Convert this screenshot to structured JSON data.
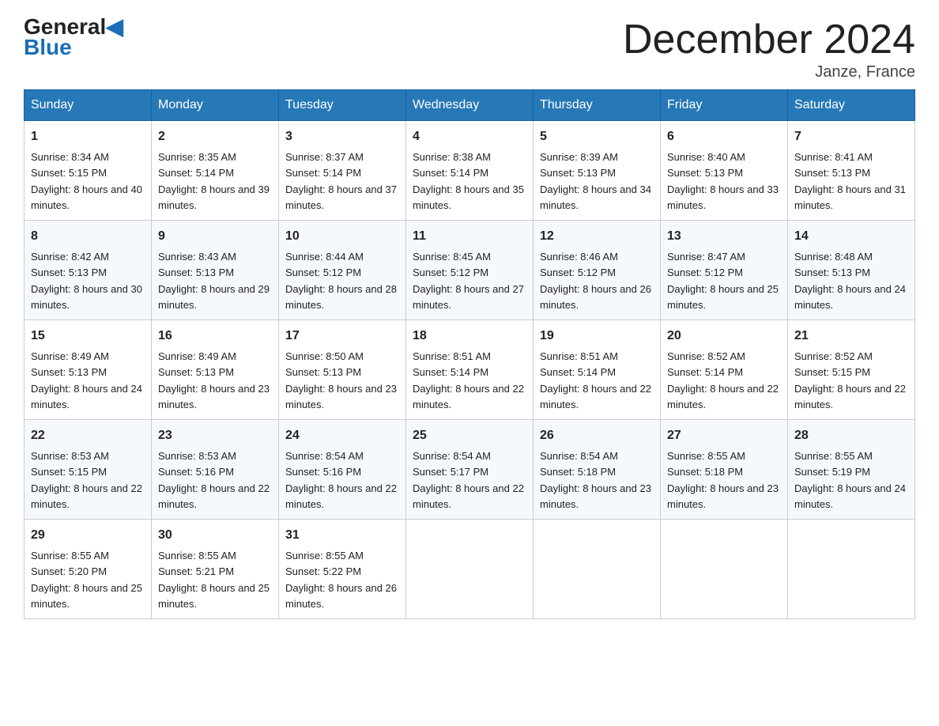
{
  "header": {
    "logo_general": "General",
    "logo_blue": "Blue",
    "month_title": "December 2024",
    "location": "Janze, France"
  },
  "weekdays": [
    "Sunday",
    "Monday",
    "Tuesday",
    "Wednesday",
    "Thursday",
    "Friday",
    "Saturday"
  ],
  "weeks": [
    [
      {
        "day": "1",
        "sunrise": "8:34 AM",
        "sunset": "5:15 PM",
        "daylight": "8 hours and 40 minutes."
      },
      {
        "day": "2",
        "sunrise": "8:35 AM",
        "sunset": "5:14 PM",
        "daylight": "8 hours and 39 minutes."
      },
      {
        "day": "3",
        "sunrise": "8:37 AM",
        "sunset": "5:14 PM",
        "daylight": "8 hours and 37 minutes."
      },
      {
        "day": "4",
        "sunrise": "8:38 AM",
        "sunset": "5:14 PM",
        "daylight": "8 hours and 35 minutes."
      },
      {
        "day": "5",
        "sunrise": "8:39 AM",
        "sunset": "5:13 PM",
        "daylight": "8 hours and 34 minutes."
      },
      {
        "day": "6",
        "sunrise": "8:40 AM",
        "sunset": "5:13 PM",
        "daylight": "8 hours and 33 minutes."
      },
      {
        "day": "7",
        "sunrise": "8:41 AM",
        "sunset": "5:13 PM",
        "daylight": "8 hours and 31 minutes."
      }
    ],
    [
      {
        "day": "8",
        "sunrise": "8:42 AM",
        "sunset": "5:13 PM",
        "daylight": "8 hours and 30 minutes."
      },
      {
        "day": "9",
        "sunrise": "8:43 AM",
        "sunset": "5:13 PM",
        "daylight": "8 hours and 29 minutes."
      },
      {
        "day": "10",
        "sunrise": "8:44 AM",
        "sunset": "5:12 PM",
        "daylight": "8 hours and 28 minutes."
      },
      {
        "day": "11",
        "sunrise": "8:45 AM",
        "sunset": "5:12 PM",
        "daylight": "8 hours and 27 minutes."
      },
      {
        "day": "12",
        "sunrise": "8:46 AM",
        "sunset": "5:12 PM",
        "daylight": "8 hours and 26 minutes."
      },
      {
        "day": "13",
        "sunrise": "8:47 AM",
        "sunset": "5:12 PM",
        "daylight": "8 hours and 25 minutes."
      },
      {
        "day": "14",
        "sunrise": "8:48 AM",
        "sunset": "5:13 PM",
        "daylight": "8 hours and 24 minutes."
      }
    ],
    [
      {
        "day": "15",
        "sunrise": "8:49 AM",
        "sunset": "5:13 PM",
        "daylight": "8 hours and 24 minutes."
      },
      {
        "day": "16",
        "sunrise": "8:49 AM",
        "sunset": "5:13 PM",
        "daylight": "8 hours and 23 minutes."
      },
      {
        "day": "17",
        "sunrise": "8:50 AM",
        "sunset": "5:13 PM",
        "daylight": "8 hours and 23 minutes."
      },
      {
        "day": "18",
        "sunrise": "8:51 AM",
        "sunset": "5:14 PM",
        "daylight": "8 hours and 22 minutes."
      },
      {
        "day": "19",
        "sunrise": "8:51 AM",
        "sunset": "5:14 PM",
        "daylight": "8 hours and 22 minutes."
      },
      {
        "day": "20",
        "sunrise": "8:52 AM",
        "sunset": "5:14 PM",
        "daylight": "8 hours and 22 minutes."
      },
      {
        "day": "21",
        "sunrise": "8:52 AM",
        "sunset": "5:15 PM",
        "daylight": "8 hours and 22 minutes."
      }
    ],
    [
      {
        "day": "22",
        "sunrise": "8:53 AM",
        "sunset": "5:15 PM",
        "daylight": "8 hours and 22 minutes."
      },
      {
        "day": "23",
        "sunrise": "8:53 AM",
        "sunset": "5:16 PM",
        "daylight": "8 hours and 22 minutes."
      },
      {
        "day": "24",
        "sunrise": "8:54 AM",
        "sunset": "5:16 PM",
        "daylight": "8 hours and 22 minutes."
      },
      {
        "day": "25",
        "sunrise": "8:54 AM",
        "sunset": "5:17 PM",
        "daylight": "8 hours and 22 minutes."
      },
      {
        "day": "26",
        "sunrise": "8:54 AM",
        "sunset": "5:18 PM",
        "daylight": "8 hours and 23 minutes."
      },
      {
        "day": "27",
        "sunrise": "8:55 AM",
        "sunset": "5:18 PM",
        "daylight": "8 hours and 23 minutes."
      },
      {
        "day": "28",
        "sunrise": "8:55 AM",
        "sunset": "5:19 PM",
        "daylight": "8 hours and 24 minutes."
      }
    ],
    [
      {
        "day": "29",
        "sunrise": "8:55 AM",
        "sunset": "5:20 PM",
        "daylight": "8 hours and 25 minutes."
      },
      {
        "day": "30",
        "sunrise": "8:55 AM",
        "sunset": "5:21 PM",
        "daylight": "8 hours and 25 minutes."
      },
      {
        "day": "31",
        "sunrise": "8:55 AM",
        "sunset": "5:22 PM",
        "daylight": "8 hours and 26 minutes."
      },
      null,
      null,
      null,
      null
    ]
  ]
}
